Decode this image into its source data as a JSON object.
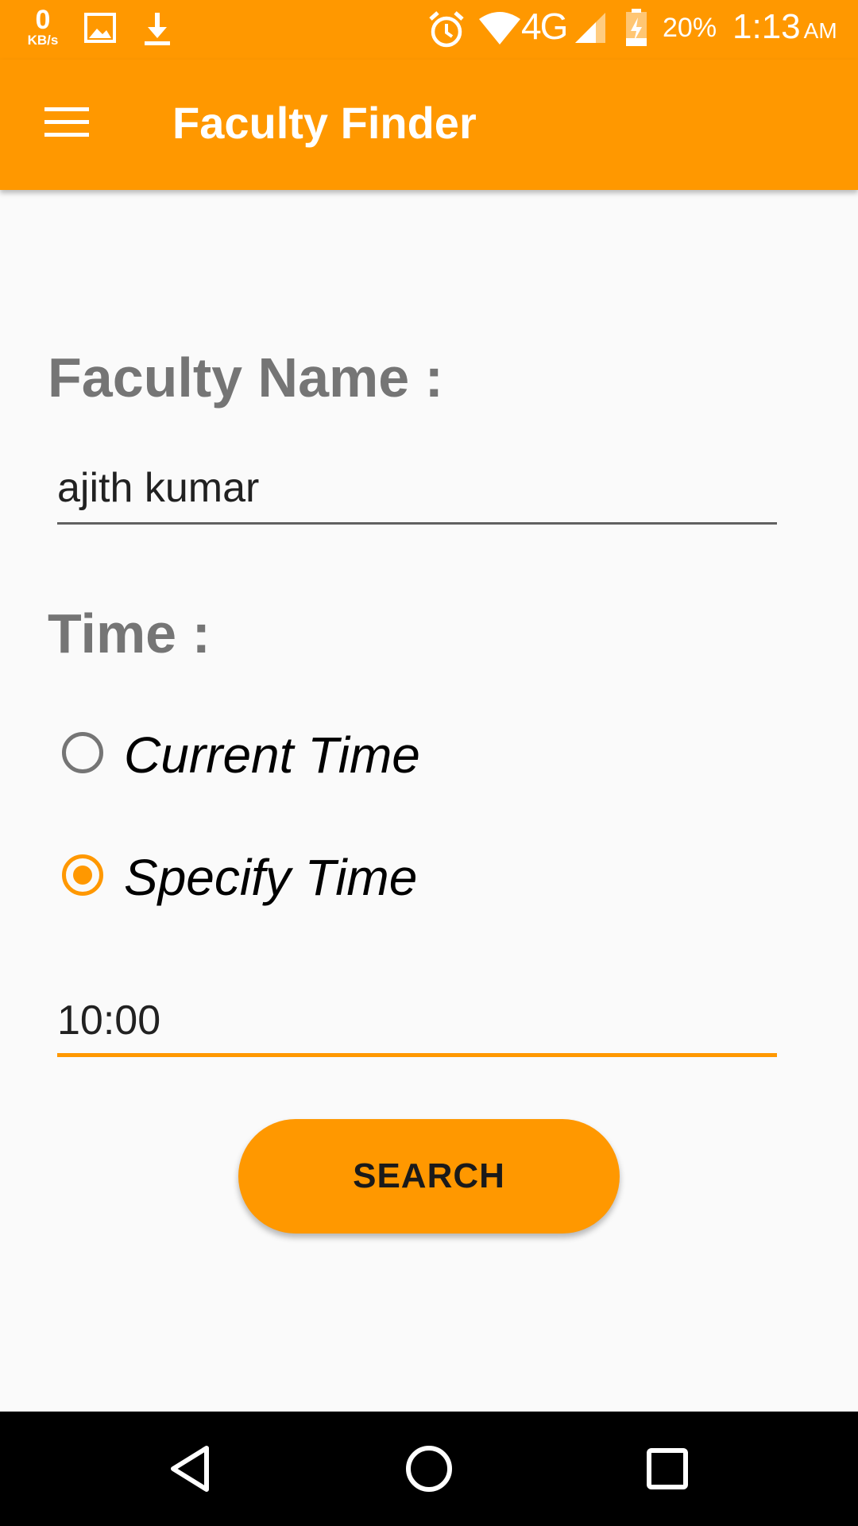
{
  "status_bar": {
    "speed_value": "0",
    "speed_unit": "KB/s",
    "icons": [
      "image-icon",
      "download-icon",
      "alarm-icon",
      "wifi-icon",
      "signal-icon",
      "battery-charging-icon"
    ],
    "network_type": "4G",
    "battery_percent": "20%",
    "time": "1:13",
    "am_pm": "AM"
  },
  "app_bar": {
    "title": "Faculty Finder",
    "menu_icon": "hamburger-menu-icon"
  },
  "form": {
    "faculty_name_label": "Faculty Name :",
    "faculty_name_value": "ajith kumar",
    "time_label": "Time :",
    "radio_options": [
      {
        "label": "Current Time",
        "checked": false
      },
      {
        "label": "Specify Time",
        "checked": true
      }
    ],
    "time_value": "10:00",
    "search_label": "SEARCH"
  },
  "nav_bar": {
    "icons": [
      "back-icon",
      "home-icon",
      "recents-icon"
    ]
  },
  "colors": {
    "accent": "#ff9800",
    "label_gray": "#757575",
    "background": "#fafafa",
    "nav_background": "#000000"
  }
}
